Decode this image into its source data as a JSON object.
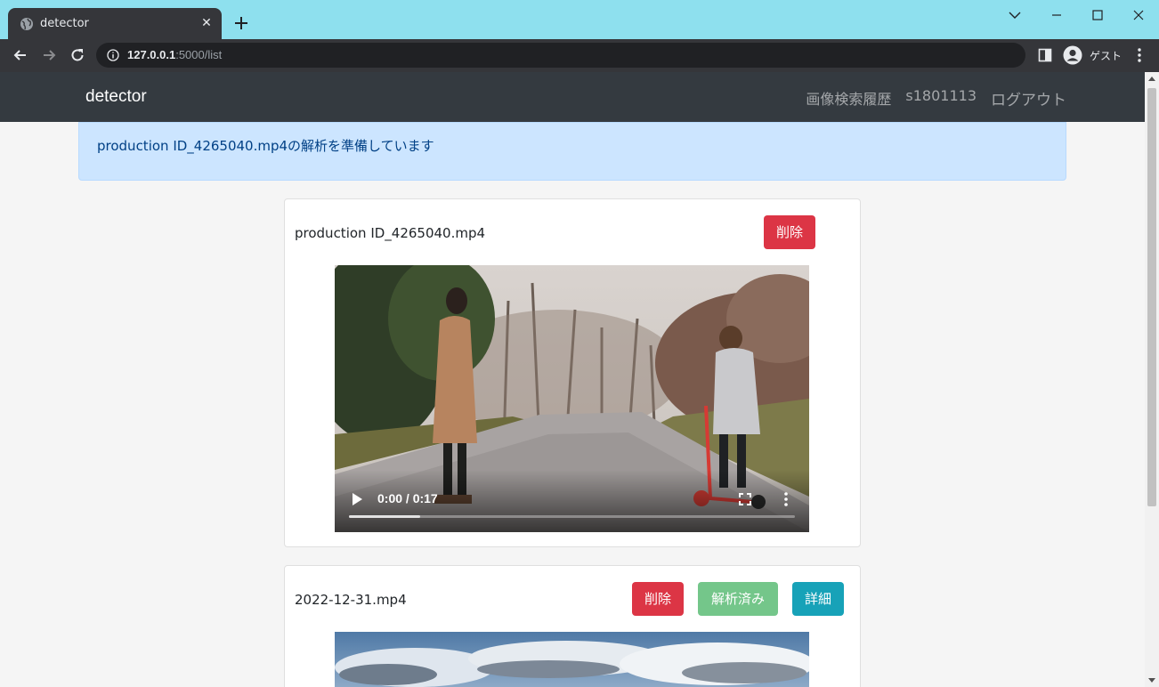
{
  "browser": {
    "tab_title": "detector",
    "url_host": "127.0.0.1",
    "url_rest": ":5000/list",
    "profile_label": "ゲスト"
  },
  "navbar": {
    "brand": "detector",
    "links": [
      "画像検索履歴",
      "s1801113",
      "ログアウト"
    ]
  },
  "alert": {
    "message": "production ID_4265040.mp4の解析を準備しています"
  },
  "videos": [
    {
      "name": "production ID_4265040.mp4",
      "delete_label": "削除",
      "time": "0:00 / 0:17",
      "buffered_fraction": 0.16
    },
    {
      "name": "2022-12-31.mp4",
      "delete_label": "削除",
      "analyzed_label": "解析済み",
      "detail_label": "詳細"
    }
  ],
  "colors": {
    "danger": "#dc3545",
    "success": "#74c68a",
    "info": "#17a2b8",
    "navbar": "#343a40",
    "alert_bg": "#cce5ff"
  }
}
